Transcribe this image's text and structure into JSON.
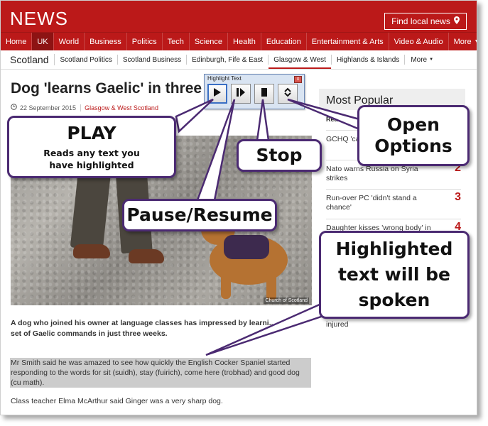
{
  "header": {
    "logo": "NEWS",
    "find_local": "Find local news"
  },
  "nav": [
    "Home",
    "UK",
    "World",
    "Business",
    "Politics",
    "Tech",
    "Science",
    "Health",
    "Education",
    "Entertainment & Arts",
    "Video & Audio",
    "More"
  ],
  "nav_active": "UK",
  "subnav": {
    "region": "Scotland",
    "items": [
      "Scotland Politics",
      "Scotland Business",
      "Edinburgh, Fife & East",
      "Glasgow & West",
      "Highlands & Islands"
    ],
    "active": "Glasgow & West",
    "more": "More"
  },
  "article": {
    "headline": "Dog 'learns Gaelic' in three",
    "date": "22 September 2015",
    "category": "Glasgow & West Scotland",
    "photo_credit": "Church of Scotland",
    "intro": "A dog who joined his owner at language classes has impressed by learni... set of Gaelic commands in just three weeks.",
    "highlighted": "Mr Smith said he was amazed to see how quickly the English Cocker Spaniel started responding to the words for sit (suidh), stay (fuirich), come here (trobhad) and good dog (cu math).",
    "para3": "Class teacher Elma McArthur said Ginger was a very sharp dog."
  },
  "most_popular": {
    "title": "Most Popular",
    "tab": "Read",
    "items": [
      {
        "text": "GCHQ 'ca... smartpho...",
        "rank": ""
      },
      {
        "text": "Nato warns Russia on Syria strikes",
        "rank": "2"
      },
      {
        "text": "Run-over PC 'didn't stand a chance'",
        "rank": "3"
      },
      {
        "text": "Daughter kisses 'wrong body' in",
        "rank": "4"
      },
      {
        "text": "injured",
        "rank": ""
      }
    ]
  },
  "toolbar": {
    "title": "Highlight Text",
    "close": "x"
  },
  "callouts": {
    "play_title": "PLAY",
    "play_desc": "Reads any text you have highlighted",
    "stop": "Stop",
    "pause": "Pause/Resume",
    "open_options": "Open Options",
    "highlighted_note": "Highlighted text will be spoken"
  },
  "colors": {
    "brand_red": "#bb1919",
    "callout_border": "#4b2a72",
    "highlight": "#cccccc",
    "toolbar_bg": "#d9e4f2"
  }
}
